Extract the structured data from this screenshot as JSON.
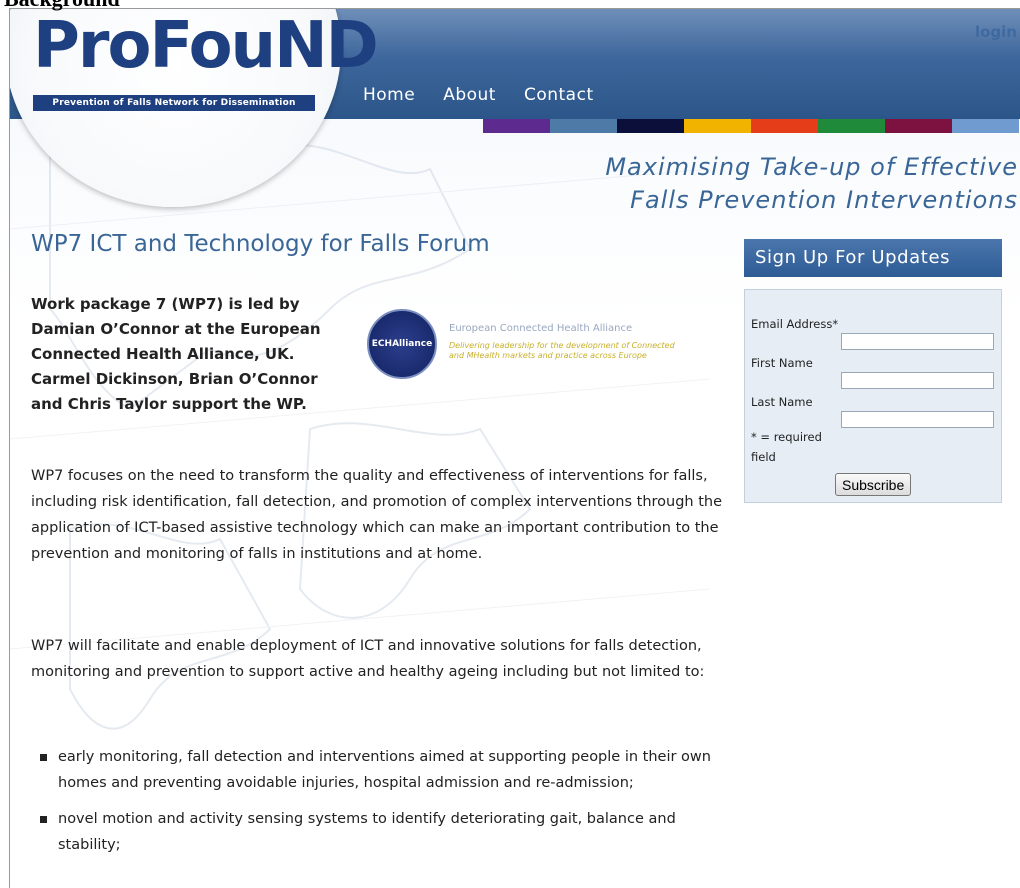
{
  "stray_heading": "Background",
  "header": {
    "login": "login",
    "nav": [
      "Home",
      "About",
      "Contact"
    ],
    "colorbar": [
      "#5d2a8f",
      "#4e7aa8",
      "#0b0f3a",
      "#f2b300",
      "#e53c1a",
      "#1f8b3a",
      "#7d1240",
      "#6f9bd0"
    ]
  },
  "logo": {
    "word": "ProFouND",
    "tagline": "Prevention of Falls Network for Dissemination"
  },
  "tagline": [
    "Maximising Take-up of Effective",
    "Falls Prevention Interventions"
  ],
  "page": {
    "title": "WP7 ICT and Technology for Falls Forum",
    "lead": "Work package 7 (WP7) is led by Damian O’Connor at the European Connected Health Alliance, UK. Carmel Dickinson, Brian O’Connor and Chris Taylor support the WP.",
    "partner": {
      "seal": "ECHAlliance",
      "name": "European Connected Health Alliance",
      "desc": "Delivering leadership for the development of Connected and MHealth markets and practice across Europe"
    },
    "p1": "WP7 focuses on the need to transform the quality and effectiveness of interventions for falls, including risk identification, fall detection, and promotion of complex interventions through the application of ICT-based assistive technology which can make an important contribution to the prevention and monitoring of falls in institutions and at home.",
    "p2": "WP7 will facilitate and enable deployment of ICT and innovative solutions for falls detection, monitoring and prevention to support active and healthy ageing including but not limited to:",
    "bullets": [
      "early monitoring, fall detection and interventions aimed at supporting people in their own homes and preventing avoidable injuries, hospital admission and re-admission;",
      "novel motion and activity sensing systems to identify deteriorating gait, balance and stability;"
    ]
  },
  "signup": {
    "title": "Sign Up For Updates",
    "email_label": "Email Address*",
    "first_label": "First Name",
    "last_label": "Last Name",
    "required": "* = required field",
    "button": "Subscribe"
  }
}
